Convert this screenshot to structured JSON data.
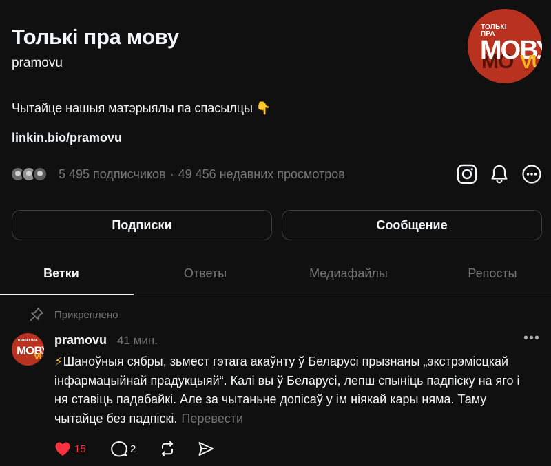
{
  "profile": {
    "name": "Толькі пра мову",
    "handle": "pramovu",
    "bio": "Чытайце нашыя матэрыялы па спасылцы",
    "bio_emoji": "👇",
    "link": "linkin.bio/pramovu",
    "followers": "5 495 подписчиков",
    "separator": "·",
    "views": "49 456 недавних просмотров",
    "avatar_logo": {
      "top_line1": "ТОЛЬКІ",
      "top_line2": "ПРА",
      "main": "МОВУ",
      "shadow": "МО",
      "accent": "VU"
    }
  },
  "header_icons": [
    "instagram-icon",
    "bell-icon",
    "more-options-icon"
  ],
  "buttons": {
    "follow": "Подписки",
    "message": "Сообщение"
  },
  "tabs": [
    {
      "label": "Ветки",
      "active": true
    },
    {
      "label": "Ответы",
      "active": false
    },
    {
      "label": "Медиафайлы",
      "active": false
    },
    {
      "label": "Репосты",
      "active": false
    }
  ],
  "post": {
    "pinned_label": "Прикреплено",
    "author": "pramovu",
    "time": "41 мин.",
    "bolt": "⚡",
    "text": "Шаноўныя сябры, зьмест гэтага акаўнту ў Беларусі прызнаны „экстрэмісцкай інфармацыйнай прадукцыяй“. Калі вы ў Беларусі, лепш спыніць падпіску на яго і ня ставіць падабайкі. Але за чытаньне допісаў у ім ніякай кары няма. Таму чытайце без падпіскі.",
    "translate": "Перевести",
    "likes": "15",
    "replies": "2",
    "avatar_logo": {
      "top": "ТОЛЬКІ ПРА",
      "main": "МОВУ",
      "accent": "VU"
    }
  },
  "colors": {
    "background": "#101010",
    "text": "#f3f5f7",
    "muted": "#777777",
    "like": "#ff3040",
    "brand": "#b8321f",
    "accent_yellow": "#f1b51c"
  }
}
